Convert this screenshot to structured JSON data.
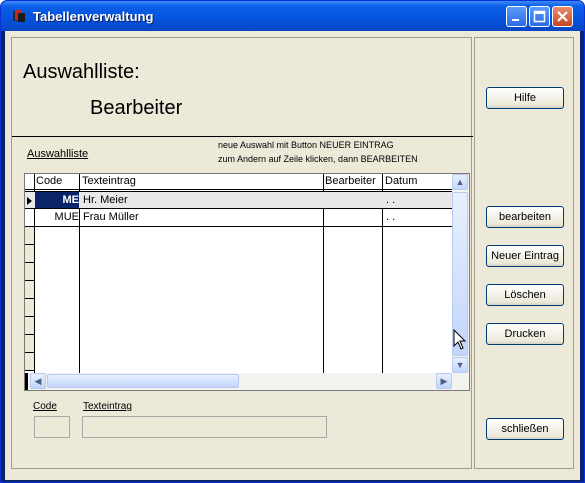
{
  "window": {
    "title": "Tabellenverwaltung"
  },
  "header": {
    "title": "Auswahlliste:",
    "subtitle": "Bearbeiter"
  },
  "list": {
    "label": "Auswahlliste",
    "hint_line1": "neue Auswahl mit Button NEUER EINTRAG",
    "hint_line2": "zum Andern auf Zeile klicken, dann BEARBEITEN",
    "columns": [
      "Code",
      "Texteintrag",
      "Bearbeiter",
      "Datum"
    ],
    "rows": [
      {
        "code": "ME",
        "text": "Hr. Meier",
        "editor": "",
        "date": ". ."
      },
      {
        "code": "MUE",
        "text": "Frau Müller",
        "editor": "",
        "date": ". ."
      }
    ]
  },
  "form": {
    "code_label": "Code",
    "text_label": "Texteintrag",
    "code_value": "",
    "text_value": ""
  },
  "buttons": {
    "help": "Hilfe",
    "edit": "bearbeiten",
    "new": "Neuer Eintrag",
    "delete": "Löschen",
    "print": "Drucken",
    "close": "schließen"
  }
}
